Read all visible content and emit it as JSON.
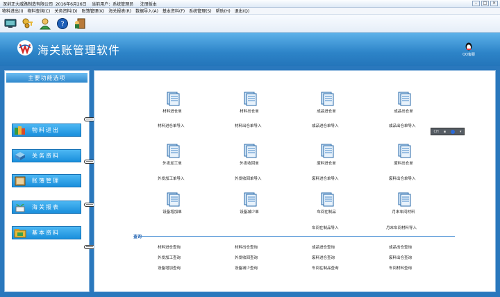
{
  "titlebar": {
    "text": "深圳正大威路制造有限公司  2016年6月26日    当前用户：系统管理员     注册版本",
    "min": "–",
    "max": "□",
    "close": "×"
  },
  "menu": [
    "物料进出(I)",
    "物料查询(C)",
    "关务资料(D)",
    "账簿管理(K)",
    "海关报表(R)",
    "数据导入(A)",
    "基本资料(F)",
    "系统管理(S)",
    "帮助(H)",
    "退出(Q)"
  ],
  "toolbar_icons": [
    "monitor-icon",
    "keys-icon",
    "user-icon",
    "help-icon",
    "exit-icon"
  ],
  "header": {
    "title": "海关账管理软件",
    "qq": "QQ客服"
  },
  "left": {
    "heading": "主要功能选项",
    "buttons": [
      "物料进出",
      "关务资料",
      "账簿管理",
      "海关报表",
      "基本资料"
    ]
  },
  "grid": {
    "row1": [
      "材料进仓单",
      "材料出仓单",
      "成品进仓单",
      "成品出仓单"
    ],
    "row1_sub": [
      "材料进仓单导入",
      "材料出仓单导入",
      "成品进仓单导入",
      "成品出仓单导入"
    ],
    "row2": [
      "外发加工单",
      "外发收回单",
      "废料进仓单",
      "废料出仓单"
    ],
    "row2_sub": [
      "外发加工单导入",
      "外发收回单导入",
      "废料进仓单导入",
      "废料出仓单导入"
    ],
    "row3": [
      "设备增加单",
      "设备减少单",
      "车间在制品",
      "月末车间材料"
    ],
    "row3_sub": [
      "车间在制品导入",
      "月末车间材料导入"
    ]
  },
  "query": {
    "title": "查询",
    "row1": [
      "材料进仓查询",
      "材料出仓查询",
      "成品进仓查询",
      "成品出仓查询"
    ],
    "row2": [
      "外发加工查询",
      "外发收回查询",
      "废料进仓查询",
      "废料出仓查询"
    ],
    "row3": [
      "设备增加查询",
      "设备减少查询",
      "车间在制品查询",
      "车间材料查询"
    ]
  },
  "mini_toolbar": {
    "label": "CH"
  },
  "colors": {
    "accent": "#2d84c8",
    "button": "#1a8fdc"
  }
}
